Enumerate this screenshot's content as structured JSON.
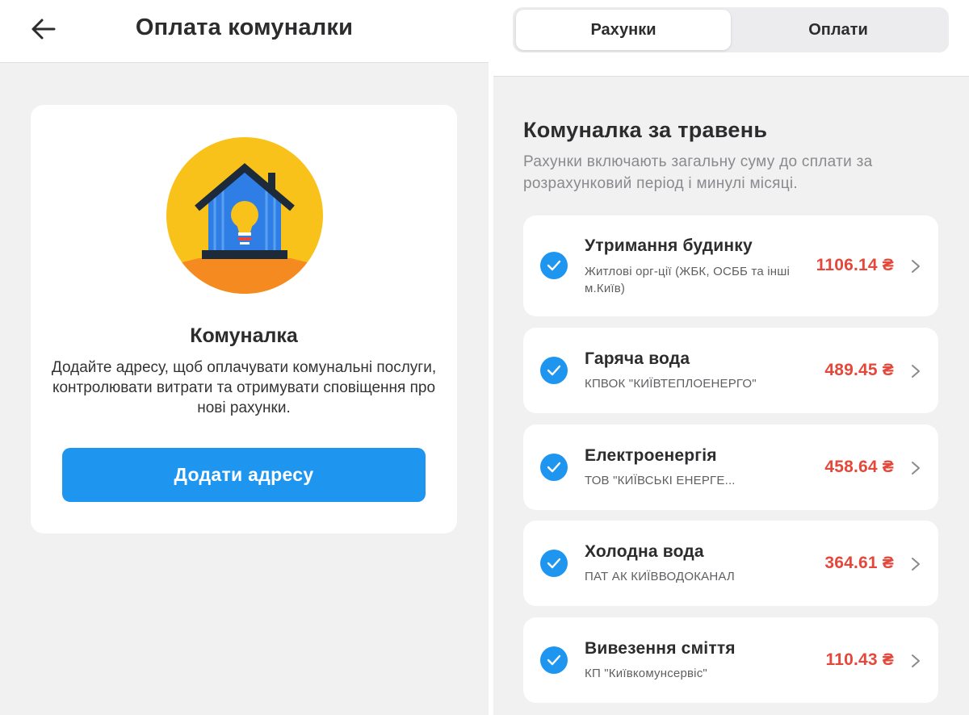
{
  "left": {
    "header_title": "Оплата комуналки",
    "card": {
      "title": "Комуналка",
      "description": "Додайте адресу, щоб оплачувати комунальні послуги, контролювати витрати та отримувати сповіщення про нові рахунки.",
      "button_label": "Додати адресу"
    }
  },
  "right": {
    "tabs": [
      {
        "label": "Рахунки",
        "active": true
      },
      {
        "label": "Оплати",
        "active": false
      }
    ],
    "section_title": "Комуналка за травень",
    "section_desc": "Рахунки включають загальну суму до сплати за розрахунковий період і минулі місяці.",
    "bills": [
      {
        "name": "Утримання будинку",
        "provider": "Житлові орг-ції (ЖБК, ОСББ та інші м.Київ)",
        "amount": "1106.14 ₴",
        "checked": true
      },
      {
        "name": "Гаряча вода",
        "provider": "КПВОК \"КИЇВТЕПЛОЕНЕРГО\"",
        "amount": "489.45 ₴",
        "checked": true
      },
      {
        "name": "Електроенергія",
        "provider": "ТОВ \"КИЇВСЬКІ ЕНЕРГЕ...",
        "amount": "458.64 ₴",
        "checked": true
      },
      {
        "name": "Холодна вода",
        "provider": "ПАТ АК КИЇВВОДОКАНАЛ",
        "amount": "364.61 ₴",
        "checked": true
      },
      {
        "name": "Вивезення сміття",
        "provider": "КП \"Київкомунсервіс\"",
        "amount": "110.43 ₴",
        "checked": true
      }
    ]
  },
  "colors": {
    "accent_blue": "#1e96f0",
    "amount_red": "#e5483a",
    "background": "#f1f1f2",
    "illustration_yellow": "#f9c21b",
    "illustration_orange": "#f58a20",
    "house_blue": "#2e7ee6"
  },
  "icons": {
    "back": "arrow-left-icon",
    "check": "check-circle-icon",
    "chevron": "chevron-right-icon",
    "illustration": "house-lightbulb-icon"
  }
}
